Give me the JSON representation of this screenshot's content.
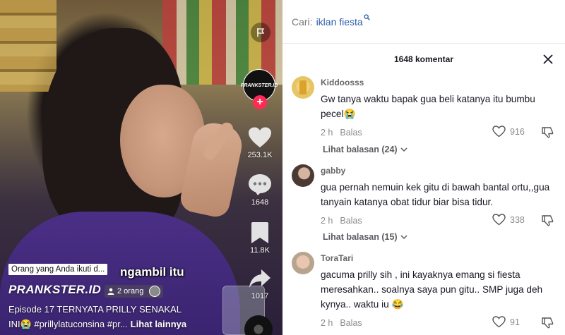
{
  "video": {
    "following_tag": "Orang yang Anda ikuti d...",
    "overlay_subtitle": "ngambil itu",
    "author_name": "PRANKSTER.ID",
    "avatar_text": "PRANKSTER.ID",
    "friends_count": "2 orang",
    "caption_line1": "Episode 17   TERNYATA PRILLY SENAKAL",
    "caption_line2": "INI😭 #prillylatuconsina #pr...",
    "caption_more": "Lihat lainnya",
    "like_count": "253.1K",
    "comment_count": "1648",
    "save_count": "11.8K",
    "share_count": "1017",
    "follow_symbol": "+"
  },
  "search": {
    "label": "Cari:",
    "term": "iklan fiesta"
  },
  "comments_header": {
    "title": "1648 komentar"
  },
  "comments": [
    {
      "username": "Kiddoosss",
      "text": "Gw tanya waktu bapak gua beli katanya itu bumbu pecel😭",
      "time": "2 h",
      "reply_label": "Balas",
      "likes": "916",
      "replies_label": "Lihat balasan (24)"
    },
    {
      "username": "gabby",
      "text": "gua pernah nemuin kek gitu di bawah bantal ortu,,gua tanyain katanya obat tidur biar bisa tidur.",
      "time": "2 h",
      "reply_label": "Balas",
      "likes": "338",
      "replies_label": "Lihat balasan (15)"
    },
    {
      "username": "ToraTari",
      "text": "gacuma prilly sih , ini kayaknya emang si fiesta meresahkan.. soalnya saya pun gitu.. SMP juga deh kynya.. waktu iu 😂",
      "time": "2 h",
      "reply_label": "Balas",
      "likes": "91"
    }
  ]
}
